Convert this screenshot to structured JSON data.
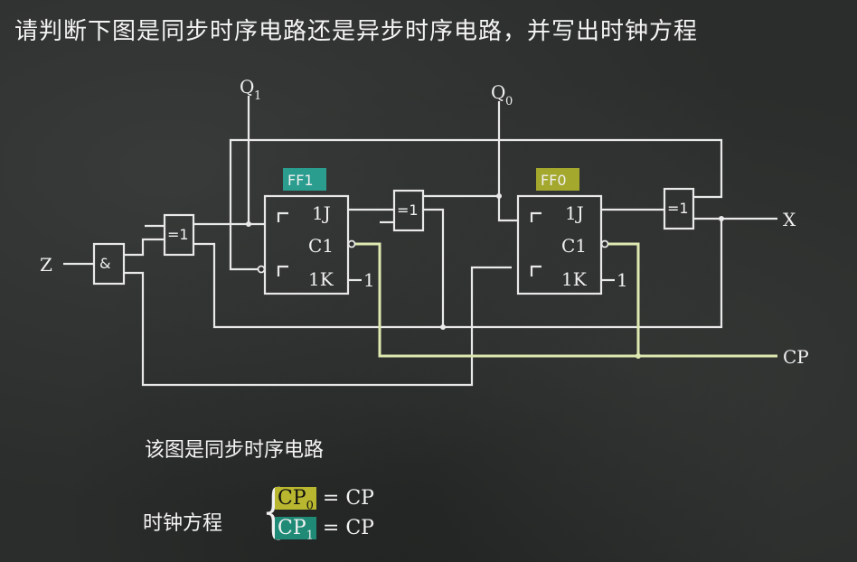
{
  "question": "请判断下图是同步时序电路还是异步时序电路，并写出时钟方程",
  "circuit": {
    "ff1_label": "FF1",
    "ff0_label": "FF0",
    "ff1_color": "#2a9d8f",
    "ff0_color": "#a4a82d",
    "pin_j": "1J",
    "pin_c": "C1",
    "pin_k": "1K",
    "k_input": "1",
    "and_gate": "&",
    "xor_gate": "=1",
    "input_z": "Z",
    "output_x": "X",
    "clock": "CP",
    "q1": "Q",
    "q1_sub": "1",
    "q0": "Q",
    "q0_sub": "0"
  },
  "answer": "该图是同步时序电路",
  "equations": {
    "label": "时钟方程",
    "rows": [
      {
        "lhs": "CP",
        "lhs_sub": "0",
        "rhs": "= CP",
        "highlight": "#b9b72f"
      },
      {
        "lhs": "CP",
        "lhs_sub": "1",
        "rhs": "= CP",
        "highlight": "#1f8a76"
      }
    ]
  }
}
